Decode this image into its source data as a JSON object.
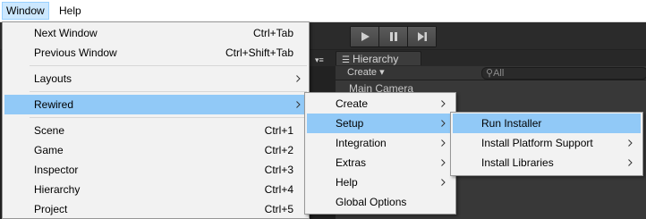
{
  "menubar": {
    "items": [
      {
        "label": "Window"
      },
      {
        "label": "Help"
      }
    ]
  },
  "editor": {
    "hierarchy_tab": "Hierarchy",
    "create_label": "Create",
    "search_placeholder": "All",
    "hierarchy_item": "Main Camera"
  },
  "window_menu": {
    "items": [
      {
        "label": "Next Window",
        "shortcut": "Ctrl+Tab"
      },
      {
        "label": "Previous Window",
        "shortcut": "Ctrl+Shift+Tab"
      },
      {
        "label": "Layouts",
        "shortcut": ""
      },
      {
        "label": "Rewired",
        "shortcut": ""
      },
      {
        "label": "Scene",
        "shortcut": "Ctrl+1"
      },
      {
        "label": "Game",
        "shortcut": "Ctrl+2"
      },
      {
        "label": "Inspector",
        "shortcut": "Ctrl+3"
      },
      {
        "label": "Hierarchy",
        "shortcut": "Ctrl+4"
      },
      {
        "label": "Project",
        "shortcut": "Ctrl+5"
      }
    ]
  },
  "rewired_menu": {
    "items": [
      {
        "label": "Create"
      },
      {
        "label": "Setup"
      },
      {
        "label": "Integration"
      },
      {
        "label": "Extras"
      },
      {
        "label": "Help"
      },
      {
        "label": "Global Options"
      }
    ]
  },
  "setup_menu": {
    "items": [
      {
        "label": "Run Installer"
      },
      {
        "label": "Install Platform Support"
      },
      {
        "label": "Install Libraries"
      }
    ]
  },
  "colors": {
    "highlight": "#91c9f7",
    "menubar_active": "#cce8ff",
    "editor_dark": "#222222"
  }
}
